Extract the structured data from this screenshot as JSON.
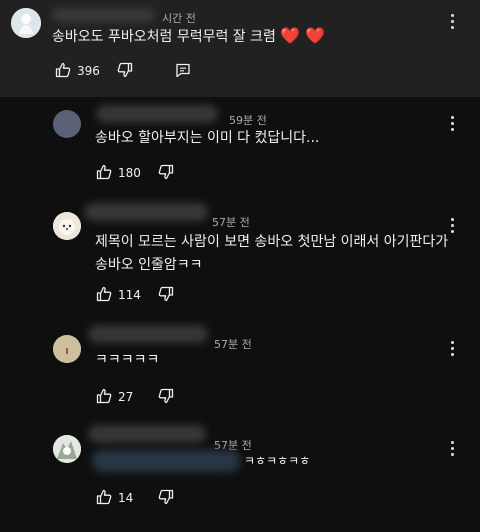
{
  "comments": [
    {
      "time": "시간 전",
      "text": "송바오도 푸바오처럼 무럭무럭 잘 크렴",
      "likes": "396"
    },
    {
      "time": "59분 전",
      "text": "송바오 할아부지는 이미 다 컸답니다...",
      "likes": "180"
    },
    {
      "time": "57분 전",
      "text": "제목이 모르는 사람이 보면 송바오 첫만남 이래서 아기판다가 송바오 인줄암ㅋㅋ",
      "likes": "114"
    },
    {
      "time": "57분 전",
      "text": "ㅋㅋㅋㅋㅋ",
      "likes": "27"
    },
    {
      "time": "57분 전",
      "text": "ㅋㅎㅋㅎㅋㅎ",
      "likes": "14"
    }
  ],
  "hearts": "❤️ ❤️"
}
